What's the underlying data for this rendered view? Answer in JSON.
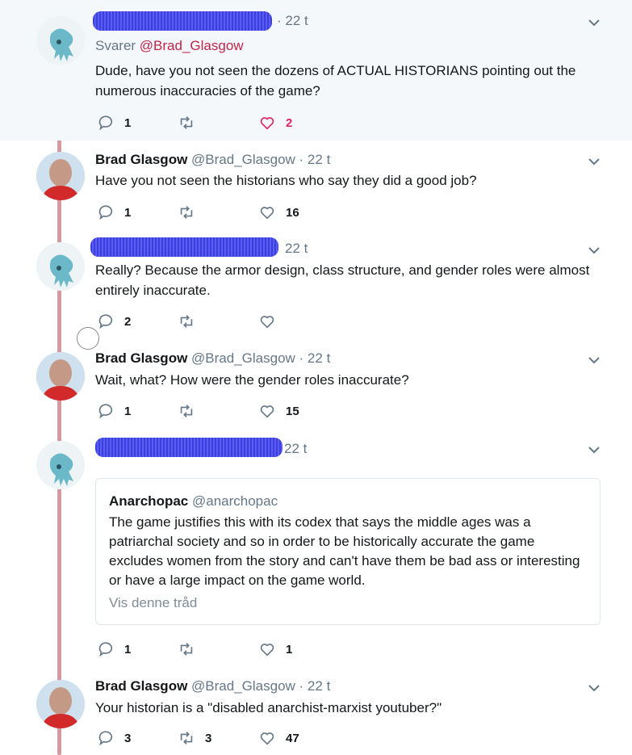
{
  "tweets": [
    {
      "time": "· 22 t",
      "replying_prefix": "Svarer ",
      "replying_handle": "@Brad_Glasgow",
      "text": "Dude, have you not seen the dozens of ACTUAL HISTORIANS pointing out the numerous inaccuracies of the game?",
      "reply_count": "1",
      "retweet_count": "",
      "like_count": "2"
    },
    {
      "name": "Brad Glasgow",
      "handle": "@Brad_Glasgow",
      "time": "· 22 t",
      "text": "Have you not seen the historians who say they did a good job?",
      "reply_count": "1",
      "retweet_count": "",
      "like_count": "16"
    },
    {
      "time": "22 t",
      "text": "Really? Because the armor design, class structure, and gender roles were almost entirely inaccurate.",
      "reply_count": "2",
      "retweet_count": "",
      "like_count": ""
    },
    {
      "name": "Brad Glasgow",
      "handle": "@Brad_Glasgow",
      "time": "· 22 t",
      "text": "Wait, what? How were the gender roles inaccurate?",
      "reply_count": "1",
      "retweet_count": "",
      "like_count": "15"
    },
    {
      "time": "22 t",
      "quote": {
        "name": "Anarchopac",
        "handle": "@anarchopac",
        "text": "The game justifies this with its codex that says the middle ages was a patriarchal society and so in order to be historically accurate the game excludes women from the story and can't have them be bad ass or interesting or have a large impact on the game world.",
        "link": "Vis denne tråd"
      },
      "reply_count": "1",
      "retweet_count": "",
      "like_count": "1"
    },
    {
      "name": "Brad Glasgow",
      "handle": "@Brad_Glasgow",
      "time": "· 22 t",
      "text": "Your historian is a \"disabled anarchist-marxist youtuber?\"",
      "reply_count": "3",
      "retweet_count": "3",
      "like_count": "47"
    }
  ],
  "icons": {
    "reply": "reply-icon",
    "retweet": "retweet-icon",
    "like": "heart-icon",
    "like_active": "heart-filled-icon",
    "more": "chevron-down-icon"
  },
  "colors": {
    "thread_line": "#d49aa2",
    "like_active": "#e0245e",
    "link": "#c0254a",
    "redaction": "#3b3fe0"
  }
}
